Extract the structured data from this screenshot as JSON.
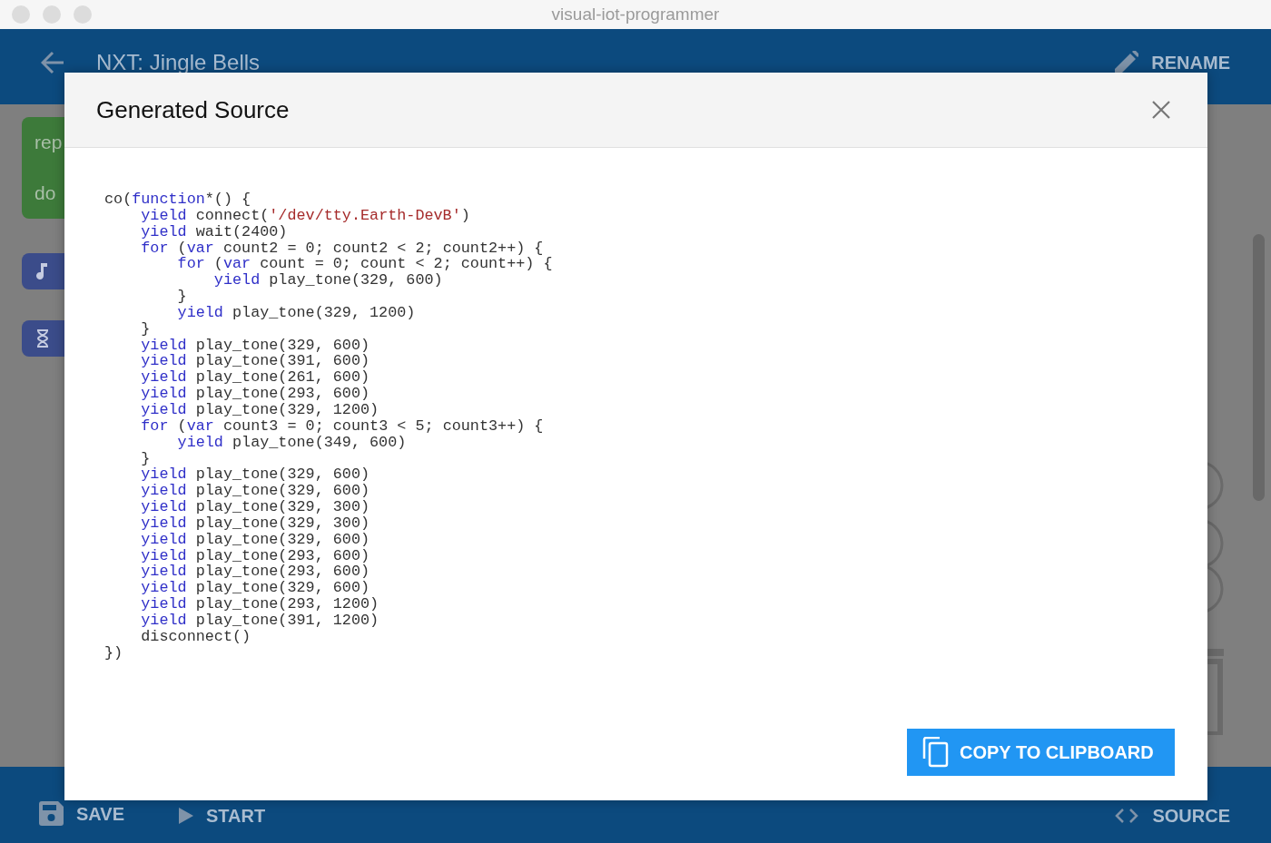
{
  "window": {
    "title": "visual-iot-programmer"
  },
  "app_bar": {
    "title": "NXT: Jingle Bells",
    "action": "RENAME"
  },
  "workspace": {
    "blocks": [
      {
        "kind": "control",
        "labels": [
          "rep",
          "do"
        ]
      },
      {
        "kind": "sound"
      },
      {
        "kind": "wait"
      }
    ]
  },
  "bottom_bar": {
    "actions": [
      {
        "kind": "save",
        "label": "SAVE"
      },
      {
        "kind": "start",
        "label": "START"
      },
      {
        "kind": "source",
        "label": "SOURCE"
      }
    ]
  },
  "dialog": {
    "title": "Generated Source",
    "button": "COPY TO CLIPBOARD",
    "code_lines": [
      [
        {
          "kind": "plain",
          "text": "co("
        },
        {
          "kind": "keyword",
          "text": "function"
        },
        {
          "kind": "plain",
          "text": "*() {"
        }
      ],
      [
        {
          "kind": "keyword",
          "text": "    yield"
        },
        {
          "kind": "plain",
          "text": " connect("
        },
        {
          "kind": "string",
          "text": "'/dev/tty.Earth-DevB'"
        },
        {
          "kind": "plain",
          "text": ")"
        }
      ],
      [
        {
          "kind": "keyword",
          "text": "    yield"
        },
        {
          "kind": "plain",
          "text": " wait(2400)"
        }
      ],
      [
        {
          "kind": "keyword",
          "text": "    for"
        },
        {
          "kind": "plain",
          "text": " ("
        },
        {
          "kind": "keyword",
          "text": "var"
        },
        {
          "kind": "plain",
          "text": " count2 = 0; count2 < 2; count2++) {"
        }
      ],
      [
        {
          "kind": "keyword",
          "text": "        for"
        },
        {
          "kind": "plain",
          "text": " ("
        },
        {
          "kind": "keyword",
          "text": "var"
        },
        {
          "kind": "plain",
          "text": " count = 0; count < 2; count++) {"
        }
      ],
      [
        {
          "kind": "keyword",
          "text": "            yield"
        },
        {
          "kind": "plain",
          "text": " play_tone(329, 600)"
        }
      ],
      [
        {
          "kind": "plain",
          "text": "        }"
        }
      ],
      [
        {
          "kind": "keyword",
          "text": "        yield"
        },
        {
          "kind": "plain",
          "text": " play_tone(329, 1200)"
        }
      ],
      [
        {
          "kind": "plain",
          "text": "    }"
        }
      ],
      [
        {
          "kind": "keyword",
          "text": "    yield"
        },
        {
          "kind": "plain",
          "text": " play_tone(329, 600)"
        }
      ],
      [
        {
          "kind": "keyword",
          "text": "    yield"
        },
        {
          "kind": "plain",
          "text": " play_tone(391, 600)"
        }
      ],
      [
        {
          "kind": "keyword",
          "text": "    yield"
        },
        {
          "kind": "plain",
          "text": " play_tone(261, 600)"
        }
      ],
      [
        {
          "kind": "keyword",
          "text": "    yield"
        },
        {
          "kind": "plain",
          "text": " play_tone(293, 600)"
        }
      ],
      [
        {
          "kind": "keyword",
          "text": "    yield"
        },
        {
          "kind": "plain",
          "text": " play_tone(329, 1200)"
        }
      ],
      [
        {
          "kind": "keyword",
          "text": "    for"
        },
        {
          "kind": "plain",
          "text": " ("
        },
        {
          "kind": "keyword",
          "text": "var"
        },
        {
          "kind": "plain",
          "text": " count3 = 0; count3 < 5; count3++) {"
        }
      ],
      [
        {
          "kind": "keyword",
          "text": "        yield"
        },
        {
          "kind": "plain",
          "text": " play_tone(349, 600)"
        }
      ],
      [
        {
          "kind": "plain",
          "text": "    }"
        }
      ],
      [
        {
          "kind": "keyword",
          "text": "    yield"
        },
        {
          "kind": "plain",
          "text": " play_tone(329, 600)"
        }
      ],
      [
        {
          "kind": "keyword",
          "text": "    yield"
        },
        {
          "kind": "plain",
          "text": " play_tone(329, 600)"
        }
      ],
      [
        {
          "kind": "keyword",
          "text": "    yield"
        },
        {
          "kind": "plain",
          "text": " play_tone(329, 300)"
        }
      ],
      [
        {
          "kind": "keyword",
          "text": "    yield"
        },
        {
          "kind": "plain",
          "text": " play_tone(329, 300)"
        }
      ],
      [
        {
          "kind": "keyword",
          "text": "    yield"
        },
        {
          "kind": "plain",
          "text": " play_tone(329, 600)"
        }
      ],
      [
        {
          "kind": "keyword",
          "text": "    yield"
        },
        {
          "kind": "plain",
          "text": " play_tone(293, 600)"
        }
      ],
      [
        {
          "kind": "keyword",
          "text": "    yield"
        },
        {
          "kind": "plain",
          "text": " play_tone(293, 600)"
        }
      ],
      [
        {
          "kind": "keyword",
          "text": "    yield"
        },
        {
          "kind": "plain",
          "text": " play_tone(329, 600)"
        }
      ],
      [
        {
          "kind": "keyword",
          "text": "    yield"
        },
        {
          "kind": "plain",
          "text": " play_tone(293, 1200)"
        }
      ],
      [
        {
          "kind": "keyword",
          "text": "    yield"
        },
        {
          "kind": "plain",
          "text": " play_tone(391, 1200)"
        }
      ],
      [
        {
          "kind": "plain",
          "text": "    disconnect()"
        }
      ],
      [
        {
          "kind": "plain",
          "text": "})"
        }
      ]
    ]
  }
}
